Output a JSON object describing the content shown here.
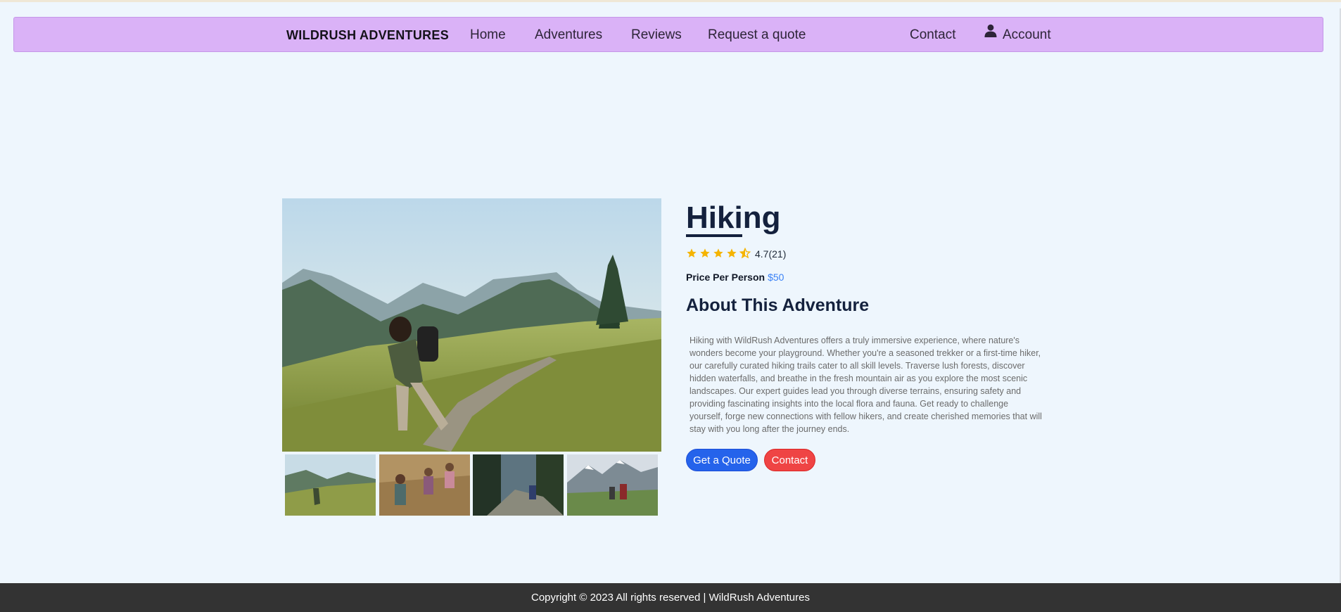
{
  "nav": {
    "brand": "WILDRUSH ADVENTURES",
    "home": "Home",
    "adventures": "Adventures",
    "reviews": "Reviews",
    "request_quote": "Request a quote",
    "contact": "Contact",
    "account": "Account",
    "background": "#dab2f7"
  },
  "adventure": {
    "title": "Hiking",
    "rating_value": "4.7",
    "rating_count": "(21)",
    "rating_stars": 4.5,
    "price_label": "Price Per Person",
    "price_value": "$50",
    "about_heading": "About This Adventure",
    "description": "Hiking with WildRush Adventures offers a truly immersive experience, where nature's wonders become your playground. Whether you're a seasoned trekker or a first-time hiker, our carefully curated hiking trails cater to all skill levels. Traverse lush forests, discover hidden waterfalls, and breathe in the fresh mountain air as you explore the most scenic landscapes. Our expert guides lead you through diverse terrains, ensuring safety and providing fascinating insights into the local flora and fauna. Get ready to challenge yourself, forge new connections with fellow hikers, and create cherished memories that will stay with you long after the journey ends.",
    "quote_button": "Get a Quote",
    "contact_button": "Contact"
  },
  "gallery": {
    "main_image": "hiker-mountain-meadow-photo",
    "thumbnails": [
      "hiker-mountain-meadow-thumb",
      "group-hikers-thumb",
      "forest-stream-hiker-thumb",
      "snowy-mountain-hikers-thumb"
    ]
  },
  "footer": {
    "text": "Copyright © 2023 All rights reserved | WildRush Adventures"
  },
  "colors": {
    "page_background": "#eef6fd",
    "star": "#f5b400",
    "price": "#3b82f6",
    "quote_button": "#2563eb",
    "contact_button": "#ef4444",
    "footer_background": "#333333"
  }
}
